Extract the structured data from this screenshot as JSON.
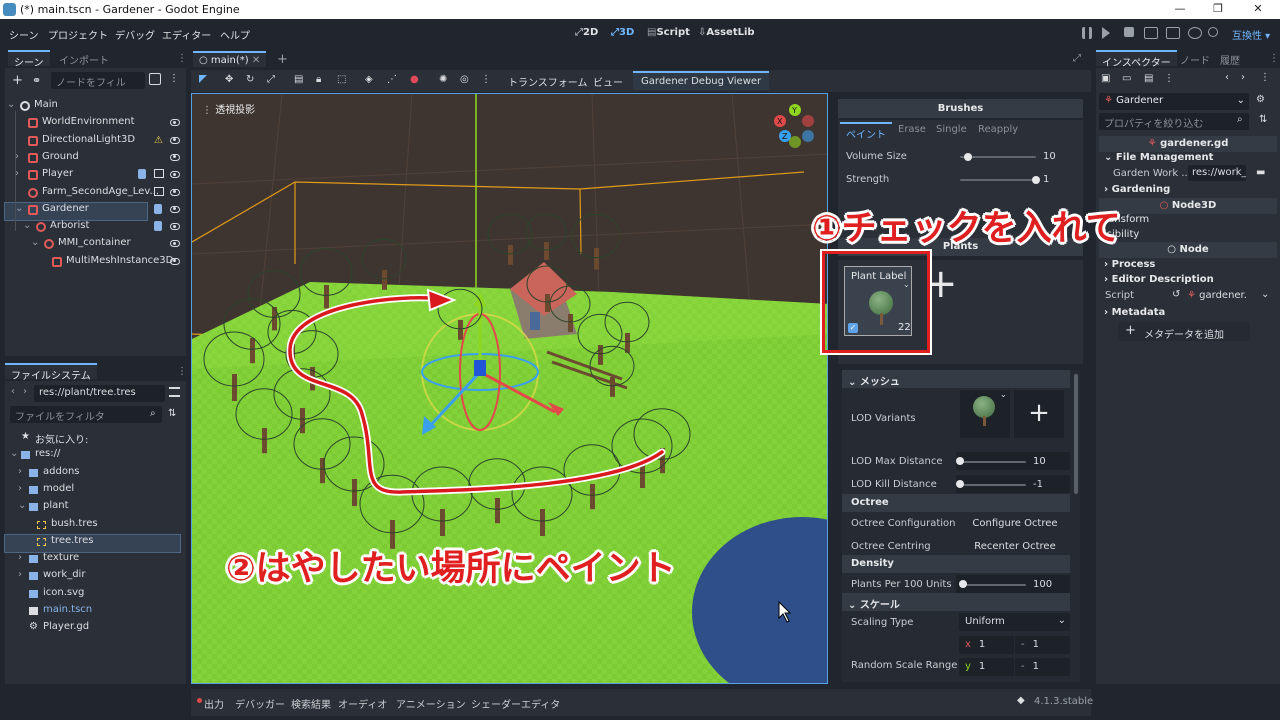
{
  "window": {
    "title": "(*) main.tscn - Gardener - Godot Engine",
    "minimize": "—",
    "maximize": "❐",
    "close": "✕"
  },
  "menu": [
    "シーン",
    "プロジェクト",
    "デバッグ",
    "エディター",
    "ヘルプ"
  ],
  "workspaces": [
    {
      "label": "2D"
    },
    {
      "label": "3D"
    },
    {
      "label": "Script"
    },
    {
      "label": "AssetLib"
    }
  ],
  "compat": "互換性",
  "scene_dock": {
    "tabs": [
      "シーン",
      "インポート"
    ],
    "filter_placeholder": "ノードをフィル",
    "nodes": [
      {
        "name": "Main",
        "icon": "node3d-icon"
      },
      {
        "name": "WorldEnvironment",
        "icon": "world-environment-icon"
      },
      {
        "name": "DirectionalLight3D",
        "icon": "directional-light-icon",
        "warning": "⚠"
      },
      {
        "name": "Ground",
        "icon": "mesh-instance-icon"
      },
      {
        "name": "Player",
        "icon": "player-icon"
      },
      {
        "name": "Farm_SecondAge_Lev...",
        "icon": "node3d-icon"
      },
      {
        "name": "Gardener",
        "icon": "gardener-icon"
      },
      {
        "name": "Arborist",
        "icon": "node3d-icon"
      },
      {
        "name": "MMI_container",
        "icon": "node3d-icon"
      },
      {
        "name": "MultiMeshInstance3D",
        "icon": "multimesh-icon"
      }
    ]
  },
  "filesystem": {
    "tab": "ファイルシステム",
    "path": "res://plant/tree.tres",
    "filter_placeholder": "ファイルをフィルタ",
    "items": [
      {
        "name": "お気に入り:",
        "icon": "star-icon"
      },
      {
        "name": "res://",
        "icon": "folder-icon"
      },
      {
        "name": "addons",
        "icon": "folder-icon"
      },
      {
        "name": "model",
        "icon": "folder-icon"
      },
      {
        "name": "plant",
        "icon": "folder-icon"
      },
      {
        "name": "bush.tres",
        "icon": "resource-icon"
      },
      {
        "name": "tree.tres",
        "icon": "resource-icon"
      },
      {
        "name": "texture",
        "icon": "folder-icon"
      },
      {
        "name": "work_dir",
        "icon": "folder-icon"
      },
      {
        "name": "icon.svg",
        "icon": "image-icon"
      },
      {
        "name": "main.tscn",
        "icon": "scene-icon"
      },
      {
        "name": "Player.gd",
        "icon": "gear-icon"
      }
    ]
  },
  "editor": {
    "tab": "main(*)",
    "add_tab": "+",
    "toolbar": {
      "transform": "トランスフォーム",
      "view": "ビュー",
      "debug_viewer": "Gardener Debug Viewer"
    },
    "viewport_label": "透視投影"
  },
  "brushes": {
    "title": "Brushes",
    "tabs": [
      "ペイント",
      "Erase",
      "Single",
      "Reapply"
    ],
    "volume_size": {
      "label": "Volume Size",
      "value": "10",
      "fraction": 0.05
    },
    "strength": {
      "label": "Strength",
      "value": "1",
      "fraction": 1.0
    }
  },
  "plants": {
    "title": "Plants",
    "card": {
      "label": "Plant Label",
      "count": "22",
      "checked": true
    },
    "add": "+"
  },
  "properties": {
    "mesh_header": "メッシュ",
    "lod_variants": "LOD Variants",
    "add": "+",
    "lod_max": {
      "label": "LOD Max Distance",
      "value": "10",
      "fraction": 0.0
    },
    "lod_kill": {
      "label": "LOD Kill Distance",
      "value": "-1",
      "fraction": 0.0
    },
    "octree_header": "Octree",
    "octree_config": {
      "label": "Octree Configuration",
      "button": "Configure Octree"
    },
    "octree_centring": {
      "label": "Octree Centring",
      "button": "Recenter Octree"
    },
    "density_header": "Density",
    "plants_per": {
      "label": "Plants Per 100 Units",
      "value": "100",
      "fraction": 0.05
    },
    "scale_header": "スケール",
    "scaling_type": {
      "label": "Scaling Type",
      "value": "Uniform"
    },
    "random_scale": {
      "label": "Random Scale Range",
      "x": "1",
      "y": "1",
      "x2": "1",
      "y2": "1",
      "xl": "x",
      "yl": "y",
      "dash": "-"
    }
  },
  "inspector": {
    "tabs": [
      "インスペクター",
      "ノード",
      "履歴"
    ],
    "object": "Gardener",
    "filter_placeholder": "プロパティを絞り込む",
    "script_file": "gardener.gd",
    "file_management": "File Management",
    "garden_work_label": "Garden Work ...",
    "garden_work_value": "res://work_",
    "gardening": "Gardening",
    "node3d": "Node3D",
    "transform_partial": "ransform",
    "visibility_partial": "isibility",
    "node_header": "Node",
    "process": "Process",
    "editor_description": "Editor Description",
    "script_label": "Script",
    "script_value": "gardener.",
    "metadata": "Metadata",
    "add_metadata": "メタデータを追加"
  },
  "bottom": {
    "tabs": [
      "出力",
      "デバッガー",
      "検索結果",
      "オーディオ",
      "アニメーション",
      "シェーダーエディタ"
    ],
    "version": "4.1.3.stable"
  },
  "annotations": {
    "one": "①チェックを入れて",
    "two": "②はやしたい場所にペイント"
  }
}
